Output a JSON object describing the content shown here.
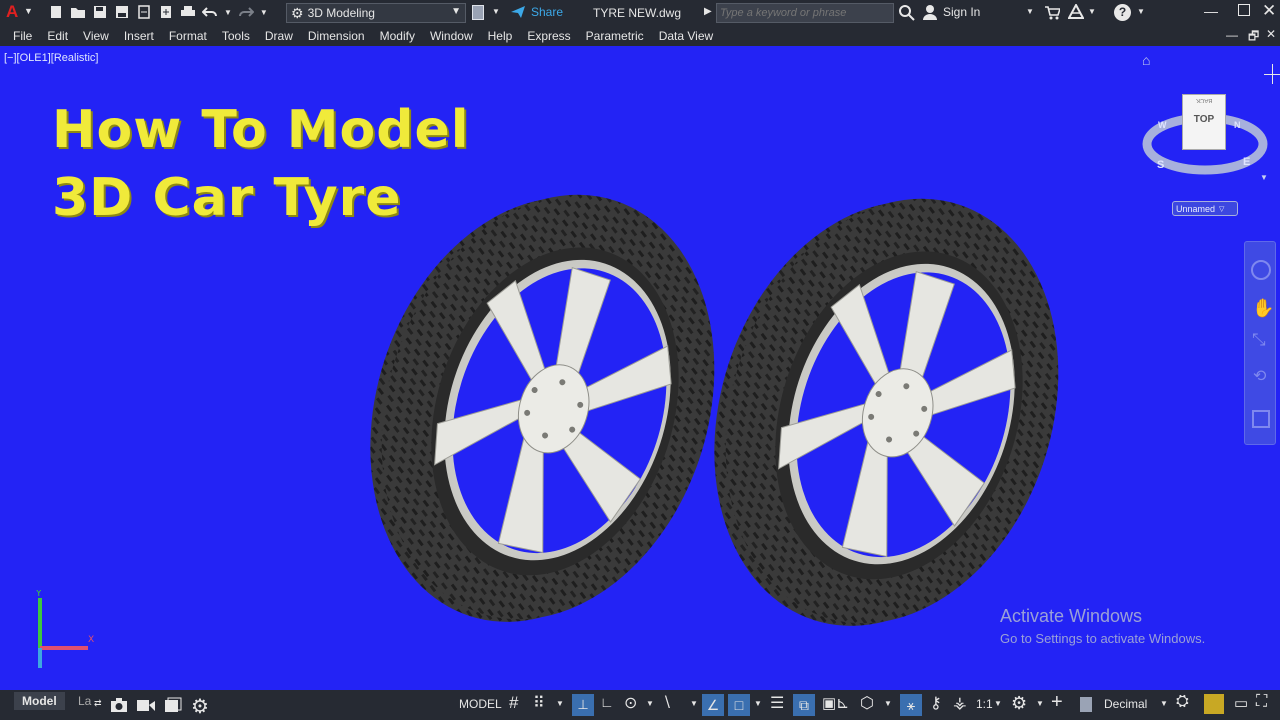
{
  "app": {
    "logo": "A",
    "workspace": "3D Modeling",
    "share_label": "Share",
    "file_title": "TYRE NEW.dwg",
    "search_placeholder": "Type a keyword or phrase",
    "sign_in": "Sign In",
    "help_icon": "question-icon"
  },
  "menu": [
    "File",
    "Edit",
    "View",
    "Insert",
    "Format",
    "Tools",
    "Draw",
    "Dimension",
    "Modify",
    "Window",
    "Help",
    "Express",
    "Parametric",
    "Data View"
  ],
  "viewport": {
    "label": "[−][OLE1][Realistic]",
    "overlay_title_line1": "How To Model",
    "overlay_title_line2": "3D Car Tyre",
    "viewcube_face": "TOP",
    "viewcube_back": "BACK",
    "compass": {
      "north": "N",
      "south": "S",
      "east": "E",
      "west": "W"
    },
    "ucs_name": "Unnamed",
    "ucs_axes": {
      "x": "X",
      "y": "Y"
    },
    "watermark_line1": "Activate Windows",
    "watermark_line2": "Go to Settings to activate Windows."
  },
  "statusbar": {
    "tab_model": "Model",
    "tab_layout": "La",
    "space": "MODEL",
    "scale": "1:1",
    "units": "Decimal"
  },
  "colors": {
    "viewport_bg": "#2323f5",
    "title_yellow": "#f0ea3a",
    "chrome": "#262a33"
  }
}
